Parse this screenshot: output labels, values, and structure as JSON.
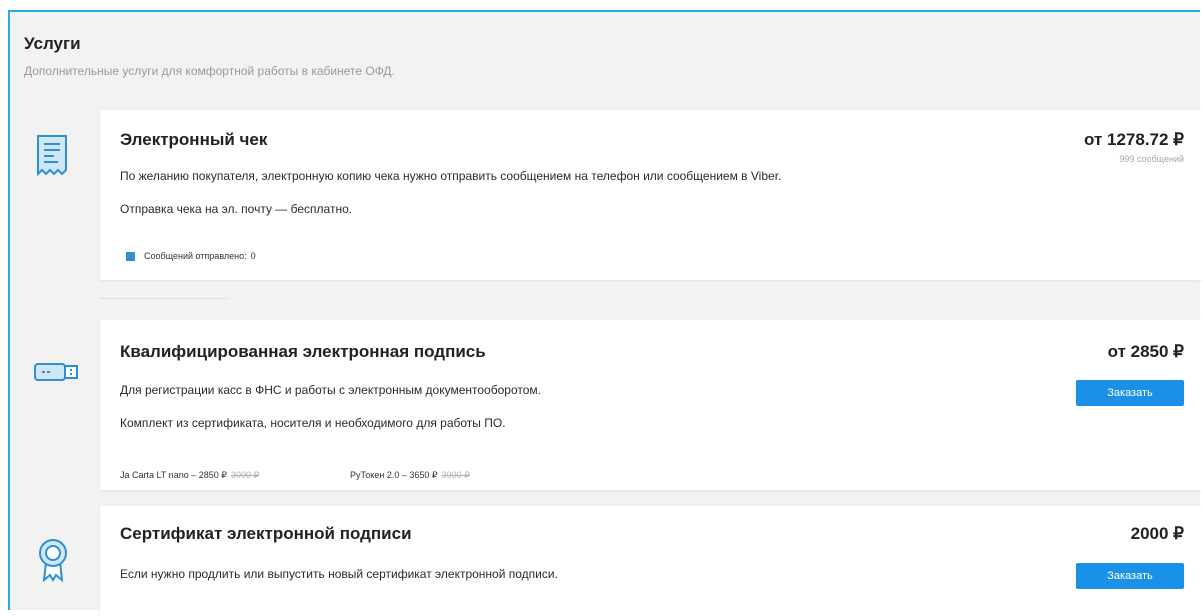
{
  "header": {
    "title": "Услуги",
    "subtitle": "Дополнительные услуги для комфортной работы в кабинете ОФД."
  },
  "services": [
    {
      "title": "Электронный чек",
      "lines": [
        "По желанию покупателя, электронную копию чека нужно отправить сообщением на телефон или сообщением в Viber.",
        "Отправка чека на эл. почту — бесплатно."
      ],
      "price": "от 1278.72 ₽",
      "price_note": "999 сообщений",
      "counter_label": "Сообщений отправлено:",
      "counter_value": "0"
    },
    {
      "title": "Квалифицированная электронная подпись",
      "lines": [
        "Для регистрации касс в ФНС и работы с электронным документооборотом.",
        "Комплект из сертификата, носителя и необходимого для работы ПО."
      ],
      "price": "от 2850 ₽",
      "button": "Заказать",
      "options": [
        {
          "label": "Ja Carta LT nano – 2850 ₽",
          "old_price": "3000 ₽"
        },
        {
          "label": "РуТокен 2.0 – 3650 ₽",
          "old_price": "3900 ₽"
        }
      ]
    },
    {
      "title": "Сертификат электронной подписи",
      "lines": [
        "Если нужно продлить или выпустить новый сертификат электронной подписи."
      ],
      "price": "2000 ₽",
      "button": "Заказать"
    }
  ],
  "colors": {
    "accent": "#1a90e6",
    "frame_border": "#2aa7e6",
    "background": "#f2f2f2"
  }
}
